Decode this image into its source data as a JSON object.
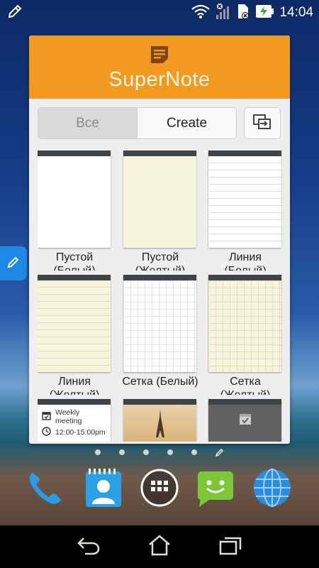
{
  "status_bar": {
    "time": "14:04",
    "icons": [
      "edit-icon",
      "wifi-icon",
      "signal-icon",
      "sim-icon",
      "battery-charging-icon"
    ]
  },
  "widget": {
    "app_name": "SuperNote",
    "tabs": [
      {
        "label": "Все",
        "selected": true
      },
      {
        "label": "Create",
        "selected": false
      }
    ],
    "import_icon": "import-icon",
    "templates": [
      {
        "label": "Пустой",
        "sub": "(Белый)",
        "style": "blank-white"
      },
      {
        "label": "Пустой",
        "sub": "(Желтый)",
        "style": "blank-yellow"
      },
      {
        "label": "Линия",
        "sub": "(Белый)",
        "style": "lined-white"
      },
      {
        "label": "Линия",
        "sub": "(Желтый)",
        "style": "lined-yellow"
      },
      {
        "label": "Сетка (Белый)",
        "sub": "",
        "style": "grid-white"
      },
      {
        "label": "Сетка",
        "sub": "(Желтый)",
        "style": "grid-yellow"
      }
    ],
    "bottom_row": {
      "meeting_title": "Weekly meeting",
      "meeting_time": "12:00-15:00pm"
    }
  },
  "page_indicator": {
    "count": 5
  },
  "dock": {
    "items": [
      "phone-icon",
      "contacts-icon",
      "app-drawer-icon",
      "messaging-icon",
      "browser-icon"
    ]
  },
  "navbar": {
    "buttons": [
      "back-icon",
      "home-icon",
      "recent-apps-icon"
    ]
  },
  "colors": {
    "accent_orange": "#f29a20",
    "edge_tab_blue": "#1e88e5",
    "messaging_green": "#7cc638"
  }
}
